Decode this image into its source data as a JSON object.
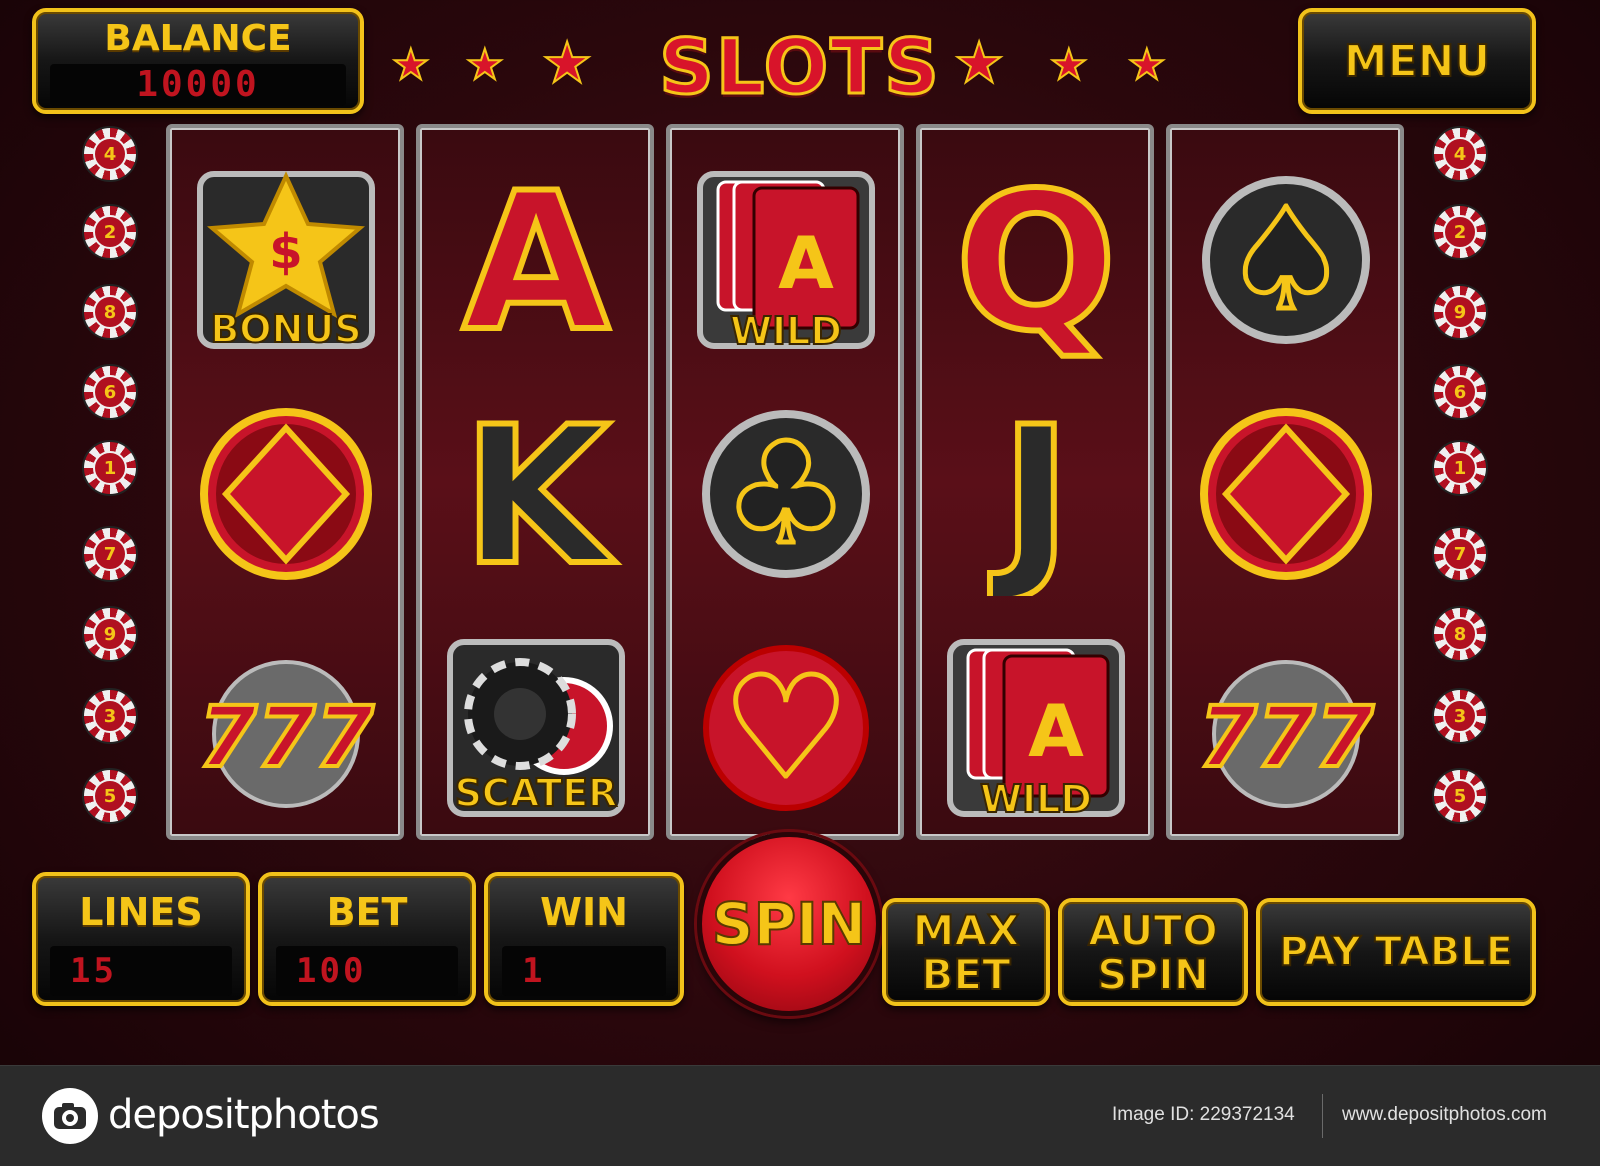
{
  "header": {
    "balance_label": "BALANCE",
    "balance_value": "10000",
    "title": "SLOTS",
    "menu_label": "MENU"
  },
  "colors": {
    "accent_yellow": "#f5c518",
    "accent_red": "#d8142a",
    "background": "#2a070c",
    "panel_black": "#050505"
  },
  "paylines_left": [
    "4",
    "2",
    "8",
    "6",
    "1",
    "7",
    "9",
    "3",
    "5"
  ],
  "paylines_right": [
    "4",
    "2",
    "9",
    "6",
    "1",
    "7",
    "8",
    "3",
    "5"
  ],
  "reels": [
    [
      {
        "icon": "bonus-star-icon",
        "glyph": "$",
        "caption": "BONUS"
      },
      {
        "icon": "diamond-icon",
        "glyph": "♦",
        "caption": ""
      },
      {
        "icon": "seven-seven-seven-icon",
        "glyph": "777",
        "caption": ""
      }
    ],
    [
      {
        "icon": "ace-letter-icon",
        "glyph": "A",
        "caption": ""
      },
      {
        "icon": "king-letter-icon",
        "glyph": "K",
        "caption": ""
      },
      {
        "icon": "poker-chips-scatter-icon",
        "glyph": "",
        "caption": "SCATER"
      }
    ],
    [
      {
        "icon": "cards-wild-icon",
        "glyph": "A",
        "caption": "WILD"
      },
      {
        "icon": "club-icon",
        "glyph": "♣",
        "caption": ""
      },
      {
        "icon": "heart-icon",
        "glyph": "♥",
        "caption": ""
      }
    ],
    [
      {
        "icon": "queen-letter-icon",
        "glyph": "Q",
        "caption": ""
      },
      {
        "icon": "jack-letter-icon",
        "glyph": "J",
        "caption": ""
      },
      {
        "icon": "cards-wild-icon",
        "glyph": "A",
        "caption": "WILD"
      }
    ],
    [
      {
        "icon": "spade-icon",
        "glyph": "♠",
        "caption": ""
      },
      {
        "icon": "diamond-icon",
        "glyph": "♦",
        "caption": ""
      },
      {
        "icon": "seven-seven-seven-icon",
        "glyph": "777",
        "caption": ""
      }
    ]
  ],
  "controls": {
    "lines_label": "LINES",
    "lines_value": "15",
    "bet_label": "BET",
    "bet_value": "100",
    "win_label": "WIN",
    "win_value": "1",
    "spin_label": "SPIN",
    "max_bet_line1": "MAX",
    "max_bet_line2": "BET",
    "auto_spin_line1": "AUTO",
    "auto_spin_line2": "SPIN",
    "pay_table_label": "PAY TABLE"
  },
  "footer": {
    "logo_text": "depositphotos",
    "image_id": "Image ID: 229372134",
    "site": "www.depositphotos.com"
  }
}
